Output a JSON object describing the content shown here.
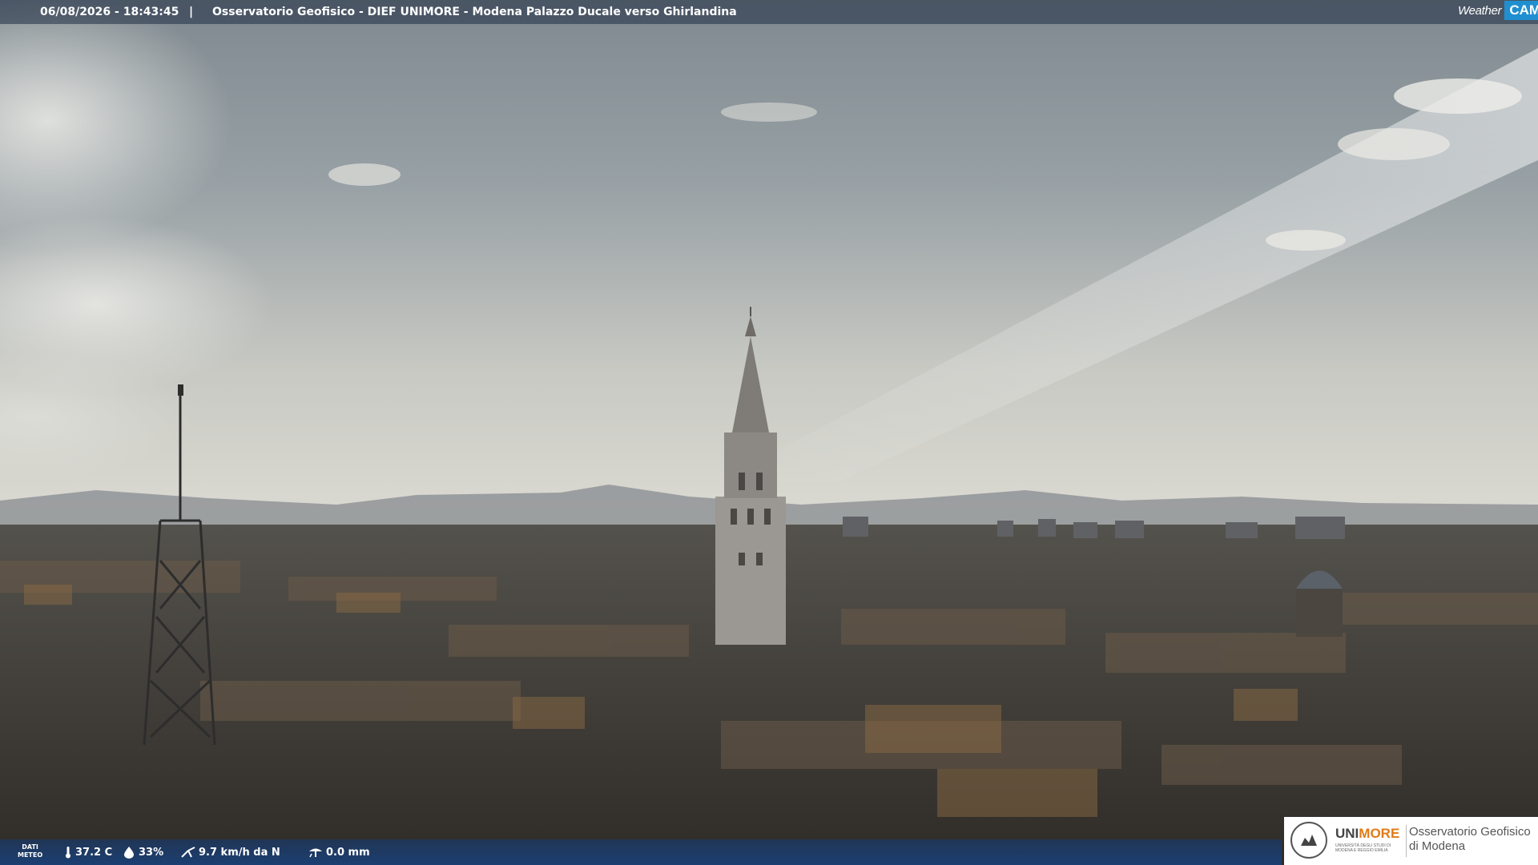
{
  "overlay": {
    "timestamp": "06/08/2026 - 18:43:45",
    "separator": "|",
    "camera_title": "Osservatorio Geofisico - DIEF UNIMORE - Modena Palazzo Ducale verso Ghirlandina"
  },
  "weathercam_logo": {
    "word": "Weather",
    "cam": "CAM"
  },
  "meteo": {
    "label_line1": "DATI",
    "label_line2": "METEO",
    "temperature": "37.2 C",
    "humidity": "33%",
    "wind": "9.7 km/h da N",
    "rain": "0.0 mm"
  },
  "unimore": {
    "brand_a": "UNI",
    "brand_b": "MORE",
    "subtitle": "UNIVERSITÀ DEGLI STUDI DI MODENA E REGGIO EMILIA",
    "observatory_line1": "Osservatorio Geofisico",
    "observatory_line2": "di Modena"
  },
  "icons": {
    "temperature": "thermometer-icon",
    "humidity": "water-drop-icon",
    "wind": "wind-icon",
    "rain": "rain-gauge-icon"
  },
  "colors": {
    "sky_top": "#8e979c",
    "sky_haze": "#d6d6ce",
    "city": "#3e3a35",
    "brand_orange": "#e07b18",
    "weathercam_blue": "#1f8fd0"
  }
}
